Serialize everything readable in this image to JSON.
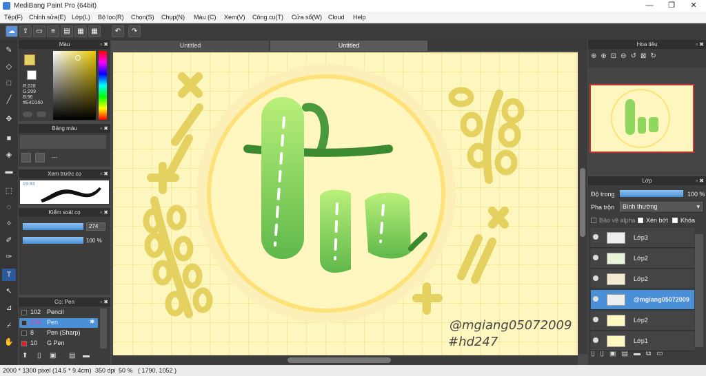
{
  "window": {
    "title": "MediBang Paint Pro (64bit)",
    "min": "—",
    "max": "❐",
    "close": "✕"
  },
  "menu": [
    "Tệp(F)",
    "Chỉnh sửa(E)",
    "Lớp(L)",
    "Bộ lọc(R)",
    "Chọn(S)",
    "Chụp(N)",
    "Màu (C)",
    "Xem(V)",
    "Công cụ(T)",
    "Cửa sổ(W)",
    "Cloud",
    "Help"
  ],
  "tabs": [
    "Untitled",
    "Untitled"
  ],
  "color_panel": {
    "title": "Màu",
    "r": "R:228",
    "g": "G:209",
    "b": "B:96",
    "hex": "#E4D160",
    "fg_color": "#e4d160",
    "bg_color": "#ffffff"
  },
  "palette_panel": {
    "title": "Bảng màu",
    "dash": "---"
  },
  "brush_preview": {
    "title": "Xem trước cọ",
    "size": "19.93"
  },
  "brush_control": {
    "title": "Kiểm soát cọ",
    "size_value": "274",
    "opacity_value": "100 %"
  },
  "brush_list": {
    "title": "Cọ: Pen",
    "items": [
      {
        "size": "102",
        "name": "Pencil",
        "color": "#333333",
        "selected": false
      },
      {
        "size": "274",
        "name": "Pen",
        "color": "#333333",
        "selected": true
      },
      {
        "size": "8",
        "name": "Pen (Sharp)",
        "color": "#333333",
        "selected": false
      },
      {
        "size": "10",
        "name": "G Pen",
        "color": "#e02020",
        "selected": false
      }
    ]
  },
  "navigator": {
    "title": "Hoa tiêu"
  },
  "layer_panel": {
    "title": "Lớp",
    "opacity_label": "Độ trong",
    "opacity_value": "100 %",
    "blend_label": "Pha trộn",
    "blend_value": "Bình thường",
    "protect_alpha": "Bảo vệ alpha",
    "clipping": "Xén bớt",
    "lock": "Khóa",
    "layers": [
      {
        "name": "Lớp3",
        "selected": false
      },
      {
        "name": "Lớp2",
        "selected": false
      },
      {
        "name": "Lớp2",
        "selected": false
      },
      {
        "name": "@mgiang05072009",
        "selected": true
      },
      {
        "name": "Lớp2",
        "selected": false
      },
      {
        "name": "Lớp1",
        "selected": false
      }
    ]
  },
  "canvas": {
    "signature1": "@mgiang05072009",
    "signature2": "#hd247",
    "bg": "#fdf7bf",
    "accent": "#e4d160"
  },
  "status": {
    "size": "2000 * 1300 pixel",
    "cm": "(14.5 * 9.4cm)",
    "dpi": "350 dpi",
    "zoom": "50 %",
    "coords": "( 1790, 1052 )"
  }
}
